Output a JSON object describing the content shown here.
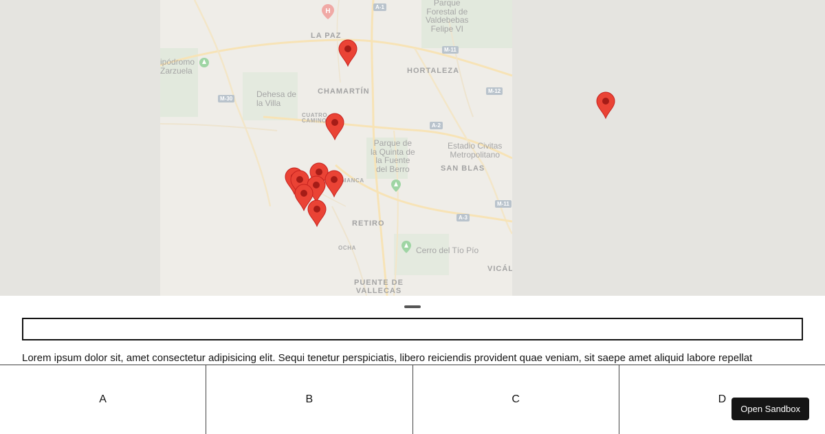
{
  "map": {
    "labels": {
      "la_paz": "LA PAZ",
      "chamartin": "CHAMARTÍN",
      "hortaleza": "HORTALEZA",
      "hipodromo": "ipódromo\nZarzuela",
      "dehesa": "Dehesa de\nla Villa",
      "cuatro_caminos": "CUATRO\nCAMINOS",
      "parque_forestal": "Parque\nForestal de\nValdebebas\nFelipe VI",
      "parque_quinta": "Parque de\nla Quinta de\nla Fuente\ndel Berro",
      "estadio": "Estadio Civitas\nMetropolitano",
      "san_blas": "SAN BLAS",
      "salamanca": "MANCA",
      "retiro": "RETIRO",
      "ochoa": "OCHA",
      "cerro": "Cerro del Tío Pío",
      "vicalvaro": "VICÁL",
      "puente_vallecas": "PUENTE DE\nVALLECAS"
    },
    "road_shields": [
      "A-1",
      "M-11",
      "M-12",
      "M-30",
      "A-2",
      "M-11",
      "A-3",
      "M-30"
    ],
    "marker_color": "#ea4335",
    "marker_count": 11
  },
  "search": {
    "placeholder": "",
    "value": ""
  },
  "description": "Lorem ipsum dolor sit, amet consectetur adipisicing elit. Sequi tenetur perspiciatis, libero reiciendis provident quae veniam, sit saepe amet aliquid labore repellat",
  "tabs": [
    "A",
    "B",
    "C",
    "D"
  ],
  "sandbox_button": "Open Sandbox"
}
